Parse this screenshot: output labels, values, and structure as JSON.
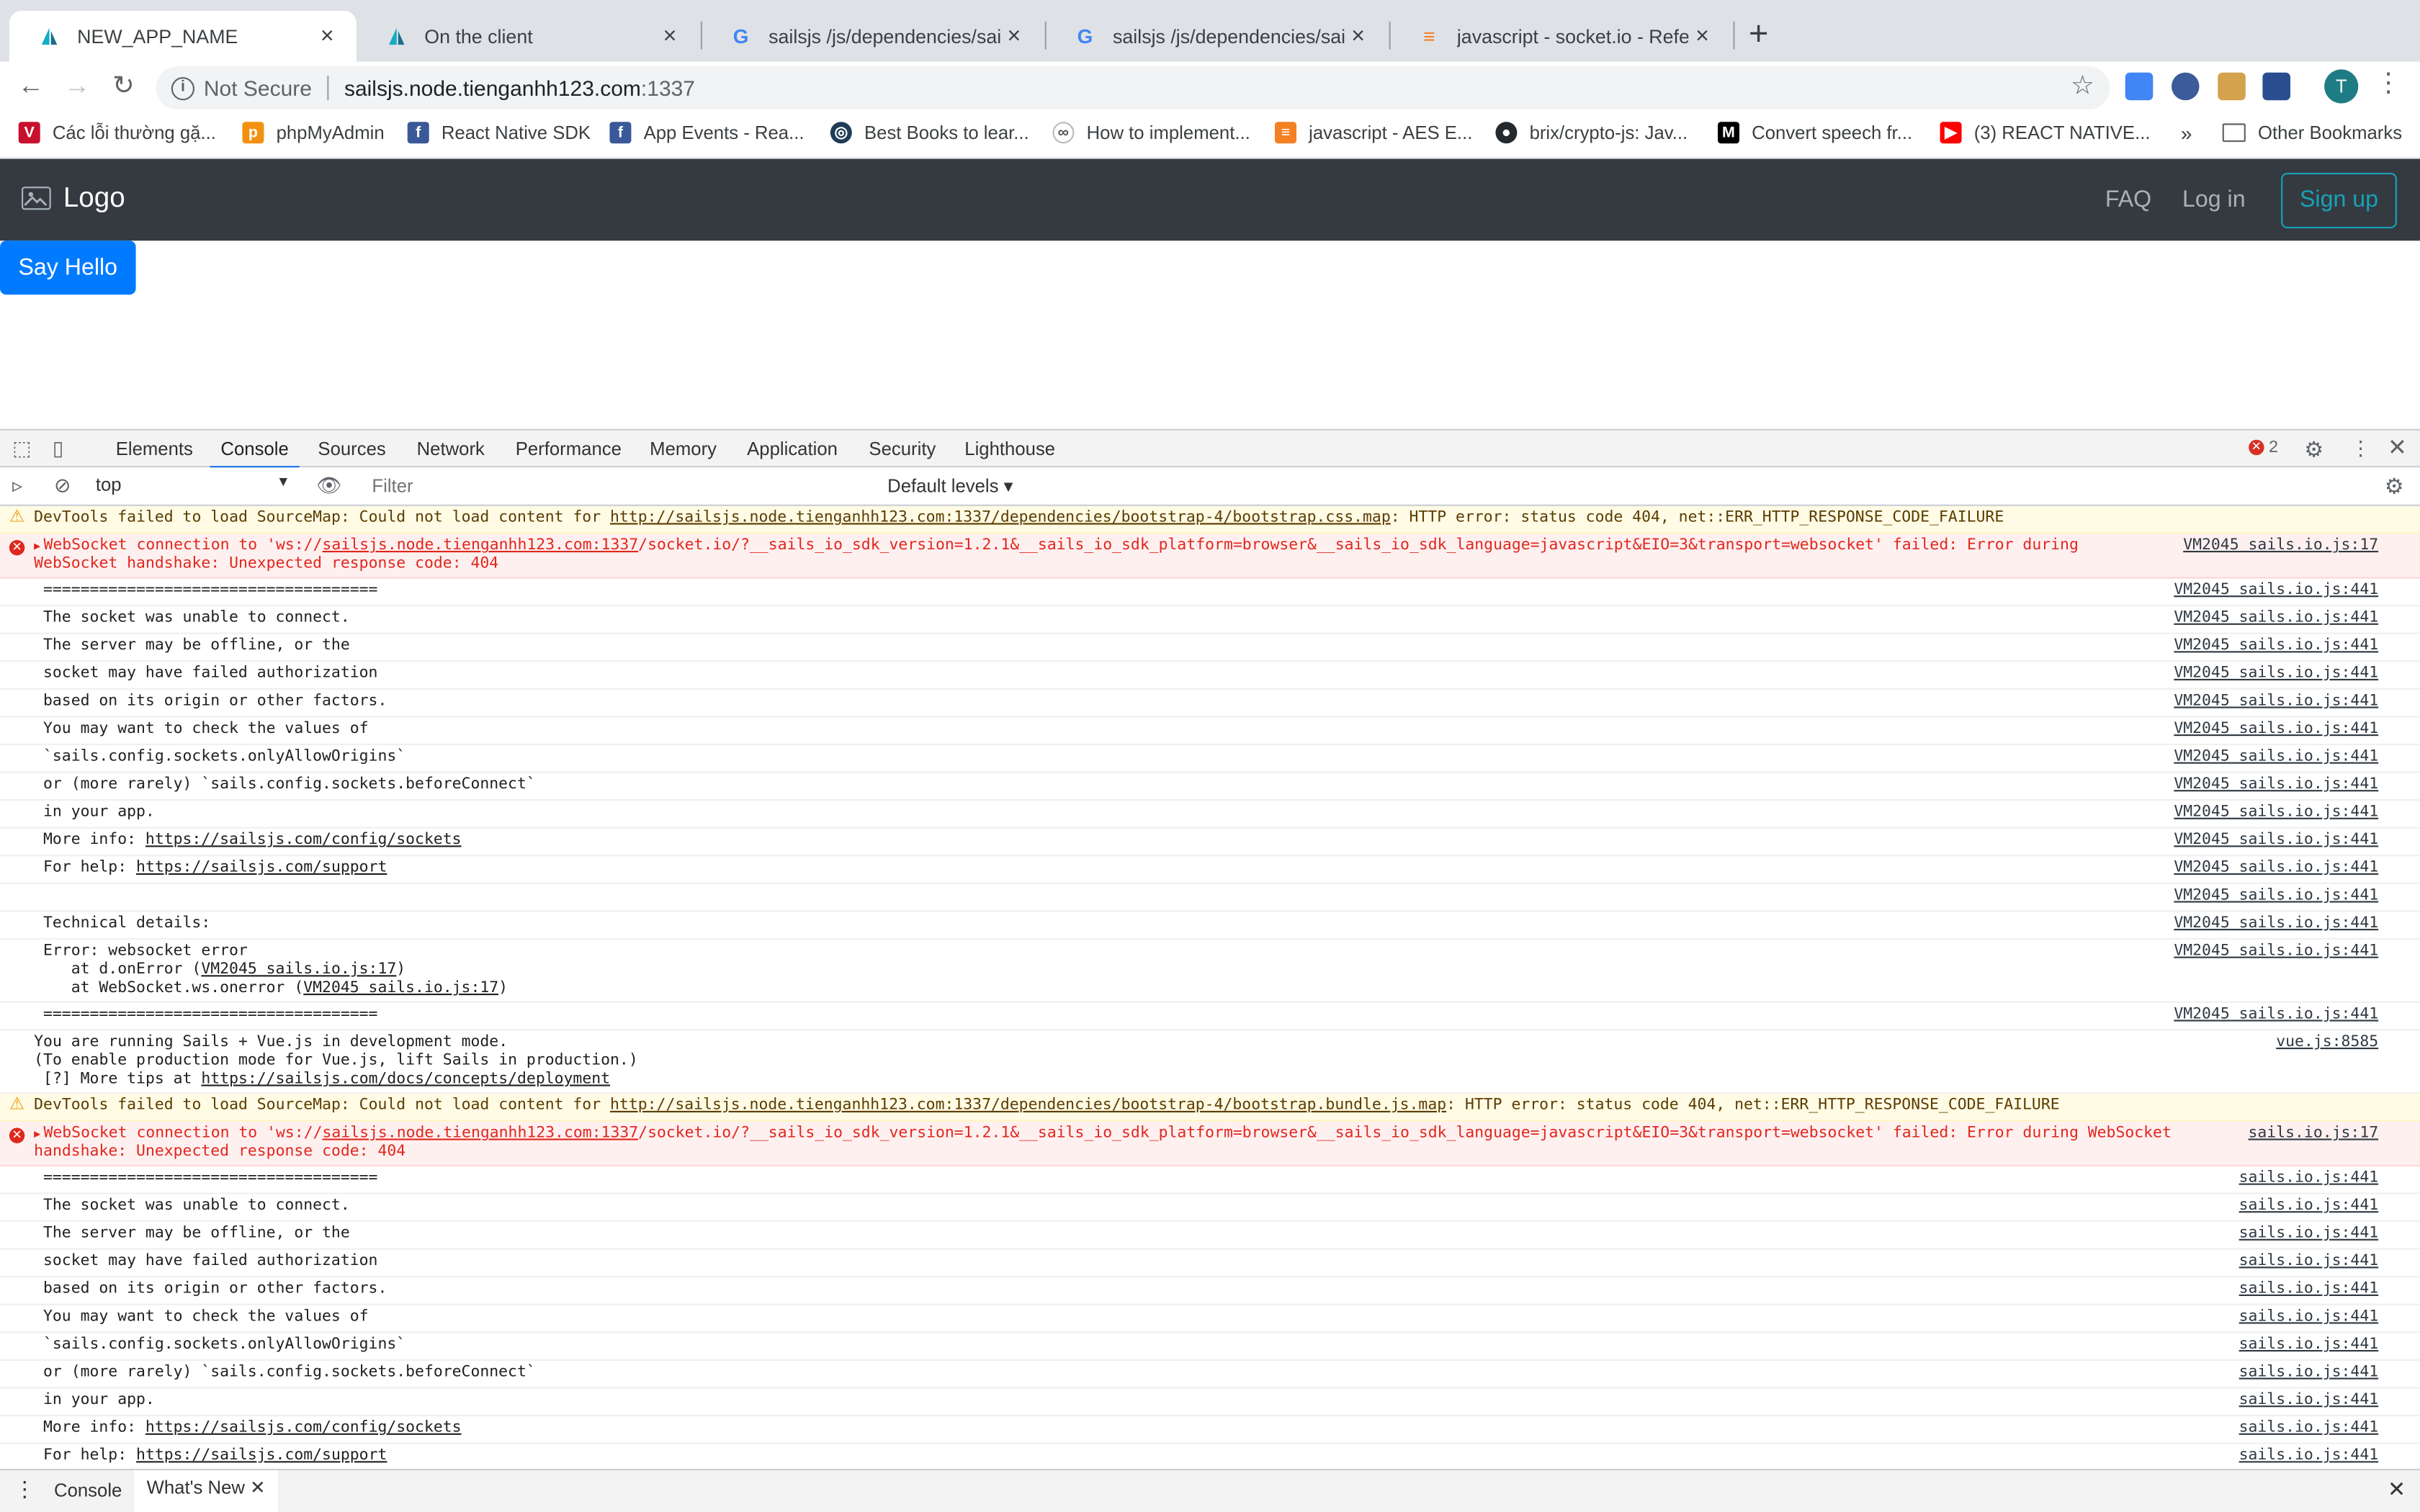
{
  "browser": {
    "tabs": [
      {
        "title": "NEW_APP_NAME"
      },
      {
        "title": "On the client"
      },
      {
        "title": "sailsjs /js/dependencies/sails.io"
      },
      {
        "title": "sailsjs /js/dependencies/sails.io"
      },
      {
        "title": "javascript - socket.io - Referen"
      }
    ],
    "new_tab": "+",
    "security": "Not Secure",
    "url_host": "sailsjs.node.tienganhh123.com",
    "url_port": ":1337",
    "avatar_letter": "T",
    "bookmarks": [
      {
        "label": "Các lỗi thường gặ..."
      },
      {
        "label": "phpMyAdmin"
      },
      {
        "label": "React Native SDK"
      },
      {
        "label": "App Events - Rea..."
      },
      {
        "label": "Best Books to lear..."
      },
      {
        "label": "How to implement..."
      },
      {
        "label": "javascript - AES E..."
      },
      {
        "label": "brix/crypto-js: Jav..."
      },
      {
        "label": "Convert speech fr..."
      },
      {
        "label": "(3) REACT NATIVE..."
      }
    ],
    "bookmarks_more": "»",
    "other_bookmarks": "Other Bookmarks"
  },
  "app": {
    "logo": "Logo",
    "nav": {
      "faq": "FAQ",
      "login": "Log in",
      "signup": "Sign up"
    },
    "say_hello": "Say Hello"
  },
  "devtools": {
    "tabs": [
      "Elements",
      "Console",
      "Sources",
      "Network",
      "Performance",
      "Memory",
      "Application",
      "Security",
      "Lighthouse"
    ],
    "active_tab": "Console",
    "error_count": "2",
    "context": "top",
    "filter_placeholder": "Filter",
    "levels": "Default levels ▾",
    "drawer_tabs": [
      "Console",
      "What's New"
    ],
    "console": {
      "warn1_pre": "DevTools failed to load SourceMap: Could not load content for ",
      "warn1_link": "http://sailsjs.node.tienganhh123.com:1337/dependencies/bootstrap-4/bootstrap.css.map",
      "warn1_post": ": HTTP error: status code 404, net::ERR_HTTP_RESPONSE_CODE_FAILURE",
      "err1_pre": "WebSocket connection to 'ws://",
      "err1_link": "sailsjs.node.tienganhh123.com:1337",
      "err1_post": "/socket.io/?__sails_io_sdk_version=1.2.1&__sails_io_sdk_platform=browser&__sails_io_sdk_language=javascript&EIO=3&transport=websocket' failed: Error during\nWebSocket handshake: Unexpected response code: 404",
      "err1_src": "VM2045 sails.io.js:17",
      "block1_src": "VM2045 sails.io.js:441",
      "block_lines": [
        "====================================",
        "The socket was unable to connect.",
        "The server may be offline, or the",
        "socket may have failed authorization",
        "based on its origin or other factors.",
        "You may want to check the values of",
        "`sails.config.sockets.onlyAllowOrigins`",
        "or (more rarely) `sails.config.sockets.beforeConnect`",
        "in your app."
      ],
      "more_info_label": "More info: ",
      "more_info_link": "https://sailsjs.com/config/sockets",
      "for_help_label": "For help: ",
      "for_help_link": "https://sailsjs.com/support",
      "tech_details": "Technical details:",
      "error_line": "Error: websocket error",
      "stack1_pre": "   at d.onError (",
      "stack1_link": "VM2045 sails.io.js:17",
      "stack2_pre": "   at WebSocket.ws.onerror (",
      "stack2_link": "VM2045 sails.io.js:17",
      "close_paren": ")",
      "separator": "====================================",
      "vue_line1": "You are running Sails + Vue.js in development mode.",
      "vue_line2": "(To enable production mode for Vue.js, lift Sails in production.)",
      "vue_line3_pre": " [?] More tips at ",
      "vue_link": "https://sailsjs.com/docs/concepts/deployment",
      "vue_src": "vue.js:8585",
      "warn2_link": "http://sailsjs.node.tienganhh123.com:1337/dependencies/bootstrap-4/bootstrap.bundle.js.map",
      "err2_post": "/socket.io/?__sails_io_sdk_version=1.2.1&__sails_io_sdk_platform=browser&__sails_io_sdk_language=javascript&EIO=3&transport=websocket' failed: Error during WebSocket\nhandshake: Unexpected response code: 404",
      "err2_src": "sails.io.js:17",
      "block2_src": "sails.io.js:441"
    }
  },
  "colors": {
    "navbar_bg": "#343a40",
    "primary": "#007bff",
    "info": "#17a2b8",
    "error": "#e0271d",
    "warning": "#f29900"
  },
  "icons": [
    "sails-favicon",
    "google-favicon",
    "stackoverflow-favicon",
    "info-icon",
    "star-icon",
    "image-icon",
    "inspect-icon",
    "device-icon",
    "gear-icon",
    "close-icon",
    "clear-console-icon",
    "eye-icon",
    "sidebar-icon",
    "folder-icon",
    "kebab-icon"
  ]
}
